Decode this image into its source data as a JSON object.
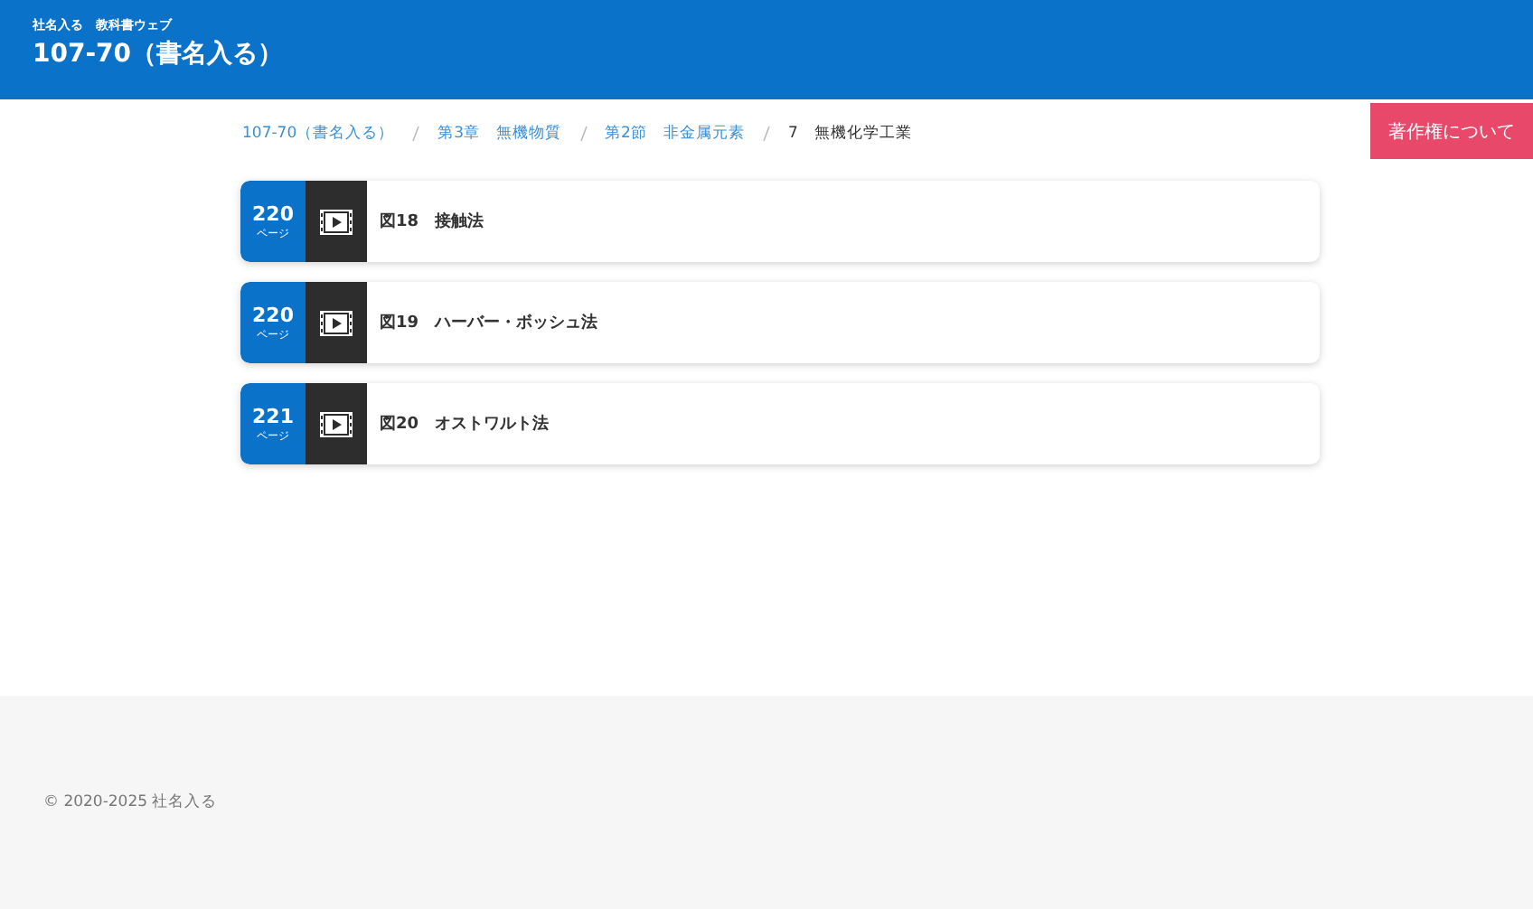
{
  "header": {
    "publisher": "社名入る　教科書ウェブ",
    "title": "107-70（書名入る）"
  },
  "breadcrumb": [
    {
      "label": "107-70（書名入る）",
      "kind": "link"
    },
    {
      "label": "第3章　無機物質",
      "kind": "link"
    },
    {
      "label": "第2節　非金属元素",
      "kind": "link"
    },
    {
      "label": "7　無機化学工業",
      "kind": "current"
    }
  ],
  "copyright_button": "著作権について",
  "items": [
    {
      "page": "220",
      "page_unit": "ページ",
      "title": "図18　接触法"
    },
    {
      "page": "220",
      "page_unit": "ページ",
      "title": "図19　ハーバー・ボッシュ法"
    },
    {
      "page": "221",
      "page_unit": "ページ",
      "title": "図20　オストワルト法"
    }
  ],
  "footer": "© 2020-2025 社名入る"
}
